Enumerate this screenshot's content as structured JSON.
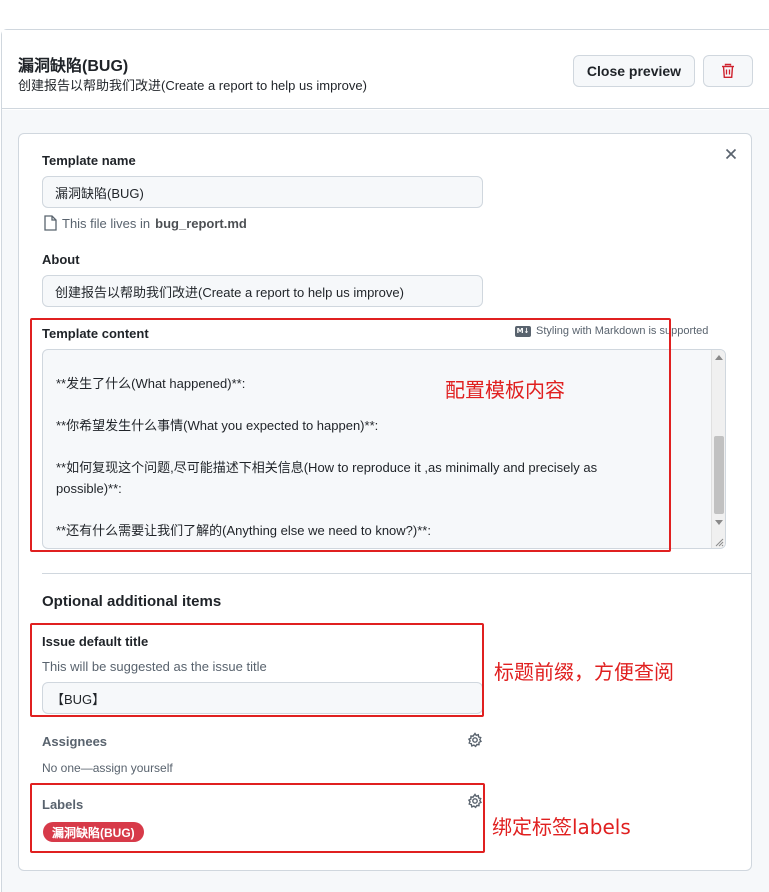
{
  "header": {
    "title": "漏洞缺陷(BUG)",
    "subtitle": "创建报告以帮助我们改进(Create a report to help us improve)",
    "close_preview_label": "Close preview"
  },
  "form": {
    "template_name_label": "Template name",
    "template_name_value": "漏洞缺陷(BUG)",
    "file_note_prefix": "This file lives in",
    "file_name": "bug_report.md",
    "about_label": "About",
    "about_value": "创建报告以帮助我们改进(Create a report to help us improve)",
    "content_label": "Template content",
    "markdown_badge": "M↓",
    "markdown_note": "Styling with Markdown is supported",
    "content_lines": [
      "**发生了什么(What happened)**:",
      "**你希望发生什么事情(What you expected to happen)**:",
      "**如何复现这个问题,尽可能描述下相关信息(How to reproduce it ,as minimally and precisely as",
      "possible)**:",
      "**还有什么需要让我们了解的(Anything else we need to know?)**:"
    ]
  },
  "optional": {
    "section_title": "Optional additional items",
    "issue_title_label": "Issue default title",
    "issue_title_help": "This will be suggested as the issue title",
    "issue_title_value": "【BUG】",
    "assignees_label": "Assignees",
    "assignees_value": "No one—assign yourself",
    "labels_label": "Labels",
    "label_pill": "漏洞缺陷(BUG)",
    "label_color": "#d73a49"
  },
  "annotations": {
    "content": "配置模板内容",
    "title_prefix": "标题前缀，方便查阅",
    "labels": "绑定标签labels",
    "color": "#e02020"
  },
  "icons": {
    "delete": "trash-icon",
    "close": "close-icon",
    "file": "file-icon",
    "markdown": "markdown-icon",
    "settings": "gear-icon"
  }
}
